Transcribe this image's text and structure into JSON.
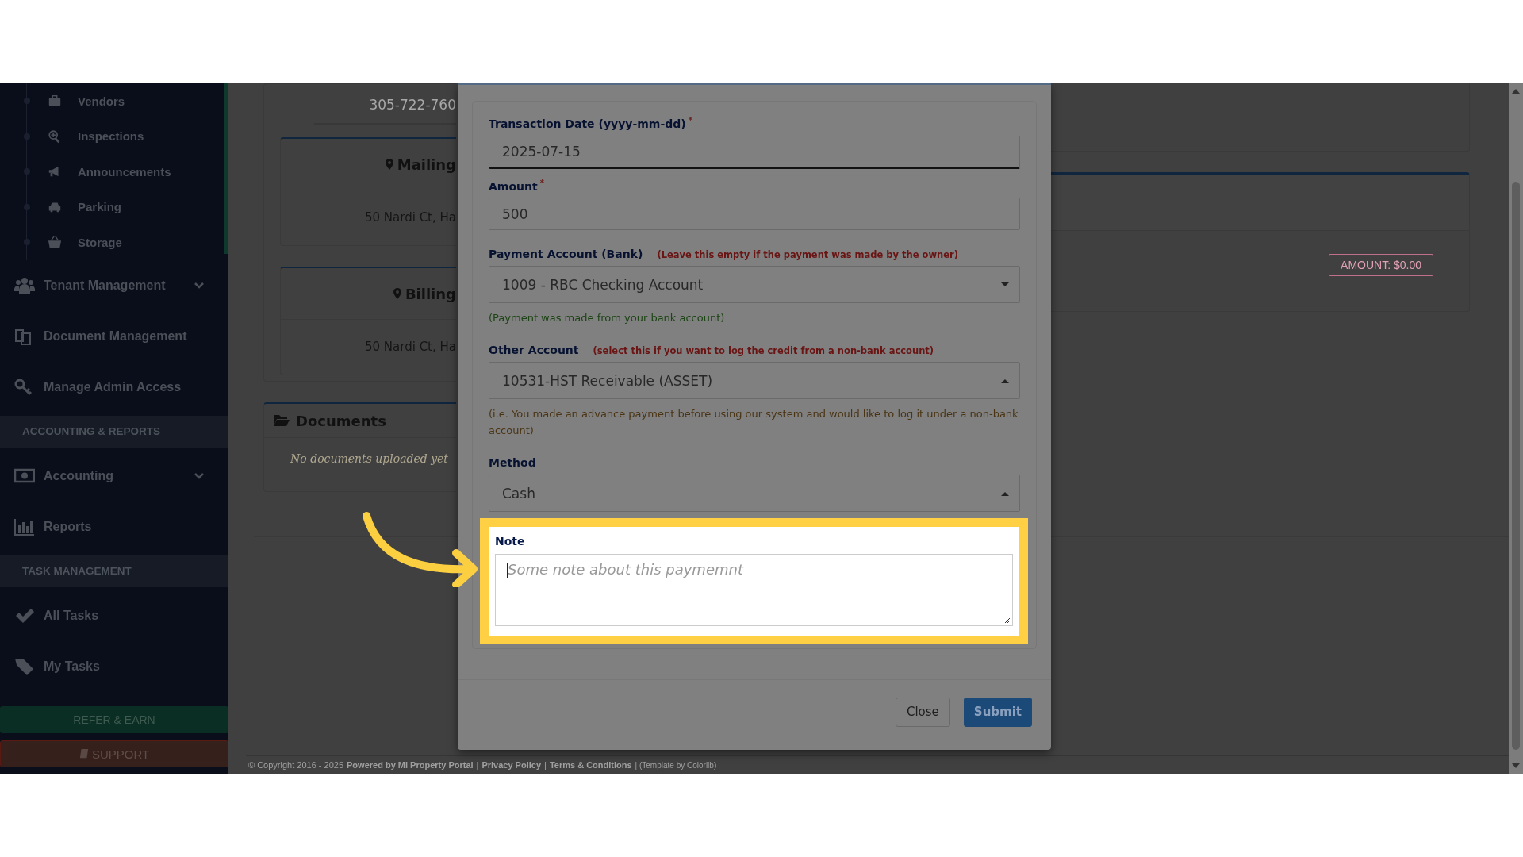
{
  "sidebar": {
    "entries": [
      {
        "kind": "subitem",
        "label": "Vendors"
      },
      {
        "kind": "subitem",
        "label": "Inspections"
      },
      {
        "kind": "subitem",
        "label": "Announcements"
      },
      {
        "kind": "subitem",
        "label": "Parking"
      },
      {
        "kind": "subitem",
        "label": "Storage"
      },
      {
        "kind": "item",
        "label": "Tenant Management",
        "expandable": true
      },
      {
        "kind": "item",
        "label": "Document Management",
        "expandable": false
      },
      {
        "kind": "item",
        "label": "Manage Admin Access",
        "expandable": false
      },
      {
        "kind": "section",
        "label": "ACCOUNTING & REPORTS"
      },
      {
        "kind": "item",
        "label": "Accounting",
        "expandable": true
      },
      {
        "kind": "item",
        "label": "Reports",
        "expandable": false
      },
      {
        "kind": "section",
        "label": "TASK MANAGEMENT"
      },
      {
        "kind": "item",
        "label": "All Tasks",
        "expandable": false
      },
      {
        "kind": "item",
        "label": "My Tasks",
        "expandable": false
      }
    ],
    "buttons": [
      {
        "kind": "refer",
        "label": "REFER & EARN"
      },
      {
        "kind": "support",
        "label": "SUPPORT"
      }
    ]
  },
  "background": {
    "phone": "305-722-760",
    "address_cards": [
      {
        "title": "Mailing",
        "address": "50 Nardi Ct, Ha"
      },
      {
        "title": "Billing",
        "address": "50 Nardi Ct, Ha"
      }
    ],
    "documents": {
      "title": "Documents",
      "empty_text": "No documents uploaded yet"
    },
    "amount_badge": "AMOUNT: $0.00",
    "footer": [
      {
        "kind": "text",
        "text": "© Copyright 2016 - 2025"
      },
      {
        "kind": "bold",
        "text": "Powered by MI Property Portal"
      },
      {
        "kind": "text",
        "text": "|"
      },
      {
        "kind": "link",
        "text": "Privacy Policy"
      },
      {
        "kind": "text",
        "text": "|"
      },
      {
        "kind": "link",
        "text": "Terms & Conditions"
      },
      {
        "kind": "small",
        "text": "| (Template by Colorlib)"
      }
    ]
  },
  "modal": {
    "fields": [
      {
        "kind": "date",
        "label": "Transaction Date (yyyy-mm-dd)",
        "required_mark": "*",
        "value": "2025-07-15"
      },
      {
        "kind": "text",
        "label": "Amount",
        "required_mark": "*",
        "value": "500"
      },
      {
        "kind": "select",
        "label": "Payment Account (Bank)",
        "label_hint": "(Leave this empty if the payment was made by the owner)",
        "value": "1009 - RBC Checking Account",
        "expanded": false,
        "help": {
          "kind": "success",
          "text": "(Payment was made from your bank account)"
        }
      },
      {
        "kind": "select",
        "label": "Other Account",
        "label_hint": "(select this if you want to log the credit from a non-bank account)",
        "value": "10531-HST Receivable (ASSET)",
        "expanded": true,
        "help": {
          "kind": "warning",
          "text": "(i.e. You made an advance payment before using our system and would like to log it under a non-bank account)"
        }
      },
      {
        "kind": "select",
        "label": "Method",
        "value": "Cash",
        "expanded": true
      }
    ],
    "note": {
      "label": "Note",
      "placeholder": "Some note about this paymemnt"
    },
    "buttons": [
      {
        "kind": "default",
        "label": "Close"
      },
      {
        "kind": "primary",
        "label": "Submit"
      }
    ]
  }
}
